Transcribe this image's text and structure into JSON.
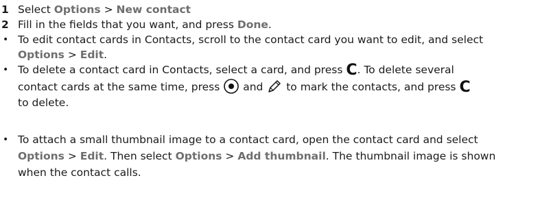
{
  "step1": {
    "number": "1",
    "prefix": "Select ",
    "menu_options": "Options",
    "sep": " > ",
    "menu_new_contact": "New contact"
  },
  "step2": {
    "number": "2",
    "text_a": "Fill in the fields that you want, and press ",
    "done": "Done",
    "text_b": "."
  },
  "bullet_edit": {
    "line1": "To edit contact cards in Contacts, scroll to the contact card you want to edit, and select",
    "opt": "Options",
    "sep": " > ",
    "edit": "Edit",
    "end": "."
  },
  "bullet_delete": {
    "line1_a": "To delete a contact card in Contacts, select a card, and press ",
    "key_c": "C",
    "line1_b": ". To delete several",
    "line2_a": "contact cards at the same time, press ",
    "line2_b": " and ",
    "line2_c": " to mark the contacts, and press ",
    "line3": "to delete."
  },
  "bullet_thumb": {
    "line1": "To attach a small thumbnail image to a contact card, open the contact card and select",
    "opt1": "Options",
    "sep1": " > ",
    "edit": "Edit",
    "mid": ". Then select ",
    "opt2": "Options",
    "sep2": " > ",
    "add_thumbnail": "Add thumbnail",
    "line2_end": ". The thumbnail image is shown",
    "line3": "when the contact calls."
  },
  "bullet_char": "•",
  "icons": [
    "select-key-icon",
    "edit-pencil-icon"
  ],
  "colors": {
    "text": "#1a1a1a",
    "menu_term": "#6e6e6e"
  }
}
